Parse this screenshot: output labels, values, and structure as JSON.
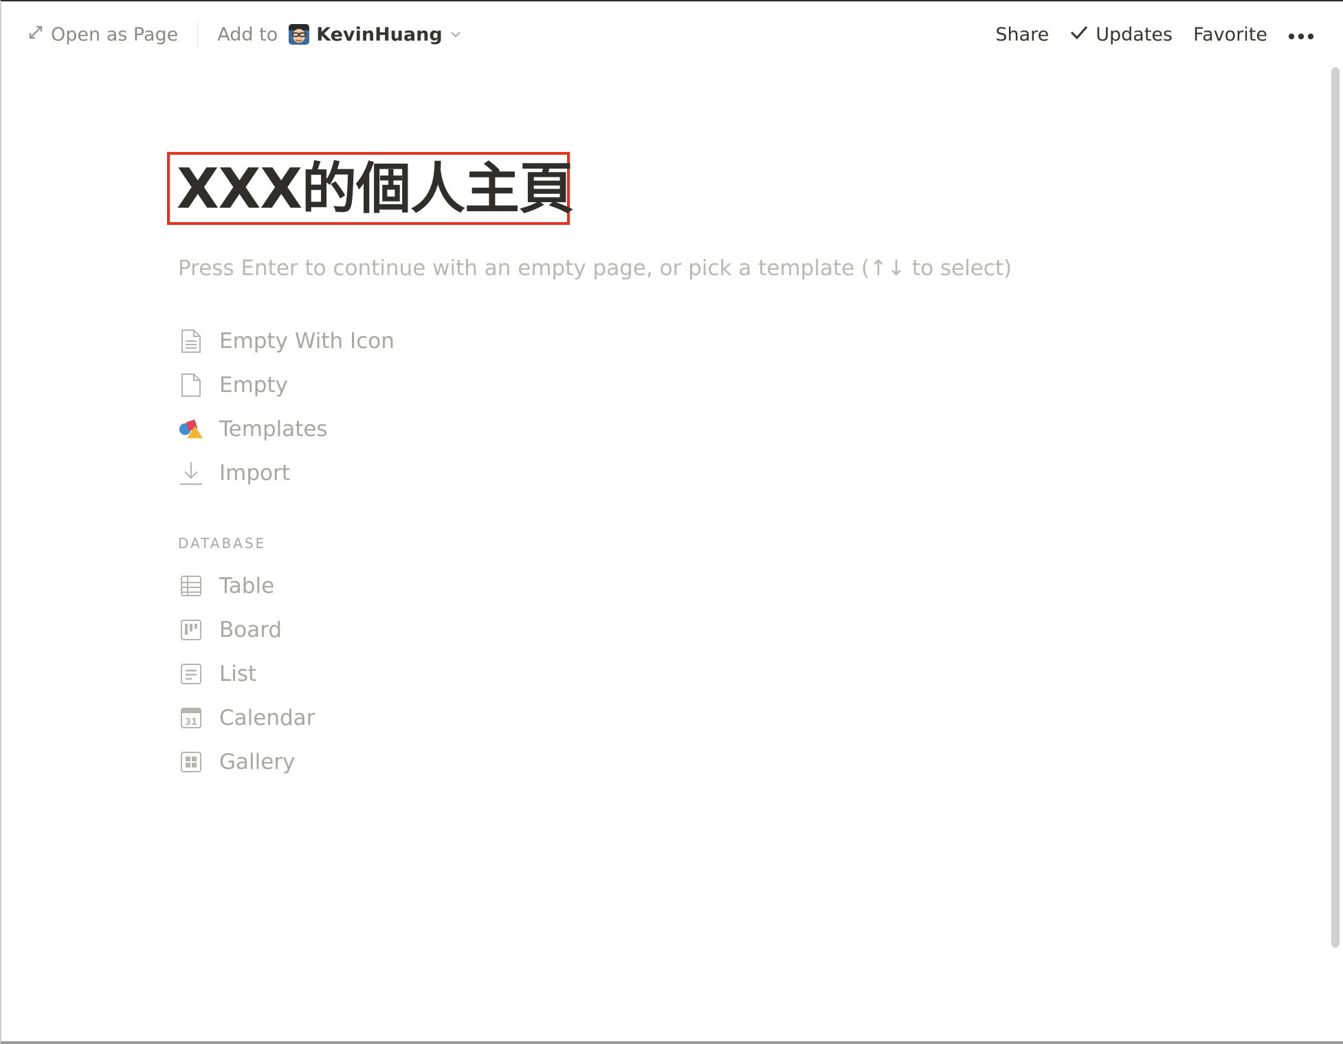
{
  "topbar": {
    "open_as_page": "Open as Page",
    "add_to": "Add to",
    "workspace_name": "KevinHuang",
    "share": "Share",
    "updates": "Updates",
    "favorite": "Favorite"
  },
  "page": {
    "title": "XXX的個人主頁",
    "hint": "Press Enter to continue with an empty page, or pick a template (↑↓ to select)"
  },
  "templates": [
    {
      "label": "Empty With Icon",
      "icon": "page-lines-icon"
    },
    {
      "label": "Empty",
      "icon": "page-icon"
    },
    {
      "label": "Templates",
      "icon": "shapes-icon"
    },
    {
      "label": "Import",
      "icon": "download-icon"
    }
  ],
  "database_section": {
    "label": "DATABASE",
    "items": [
      {
        "label": "Table",
        "icon": "table-icon"
      },
      {
        "label": "Board",
        "icon": "board-icon"
      },
      {
        "label": "List",
        "icon": "list-icon"
      },
      {
        "label": "Calendar",
        "icon": "calendar-icon",
        "icon_text": "31"
      },
      {
        "label": "Gallery",
        "icon": "gallery-icon"
      }
    ]
  },
  "colors": {
    "highlight_border": "#e8321f",
    "muted_text": "#a9a7a3",
    "primary_text": "#37352f"
  }
}
